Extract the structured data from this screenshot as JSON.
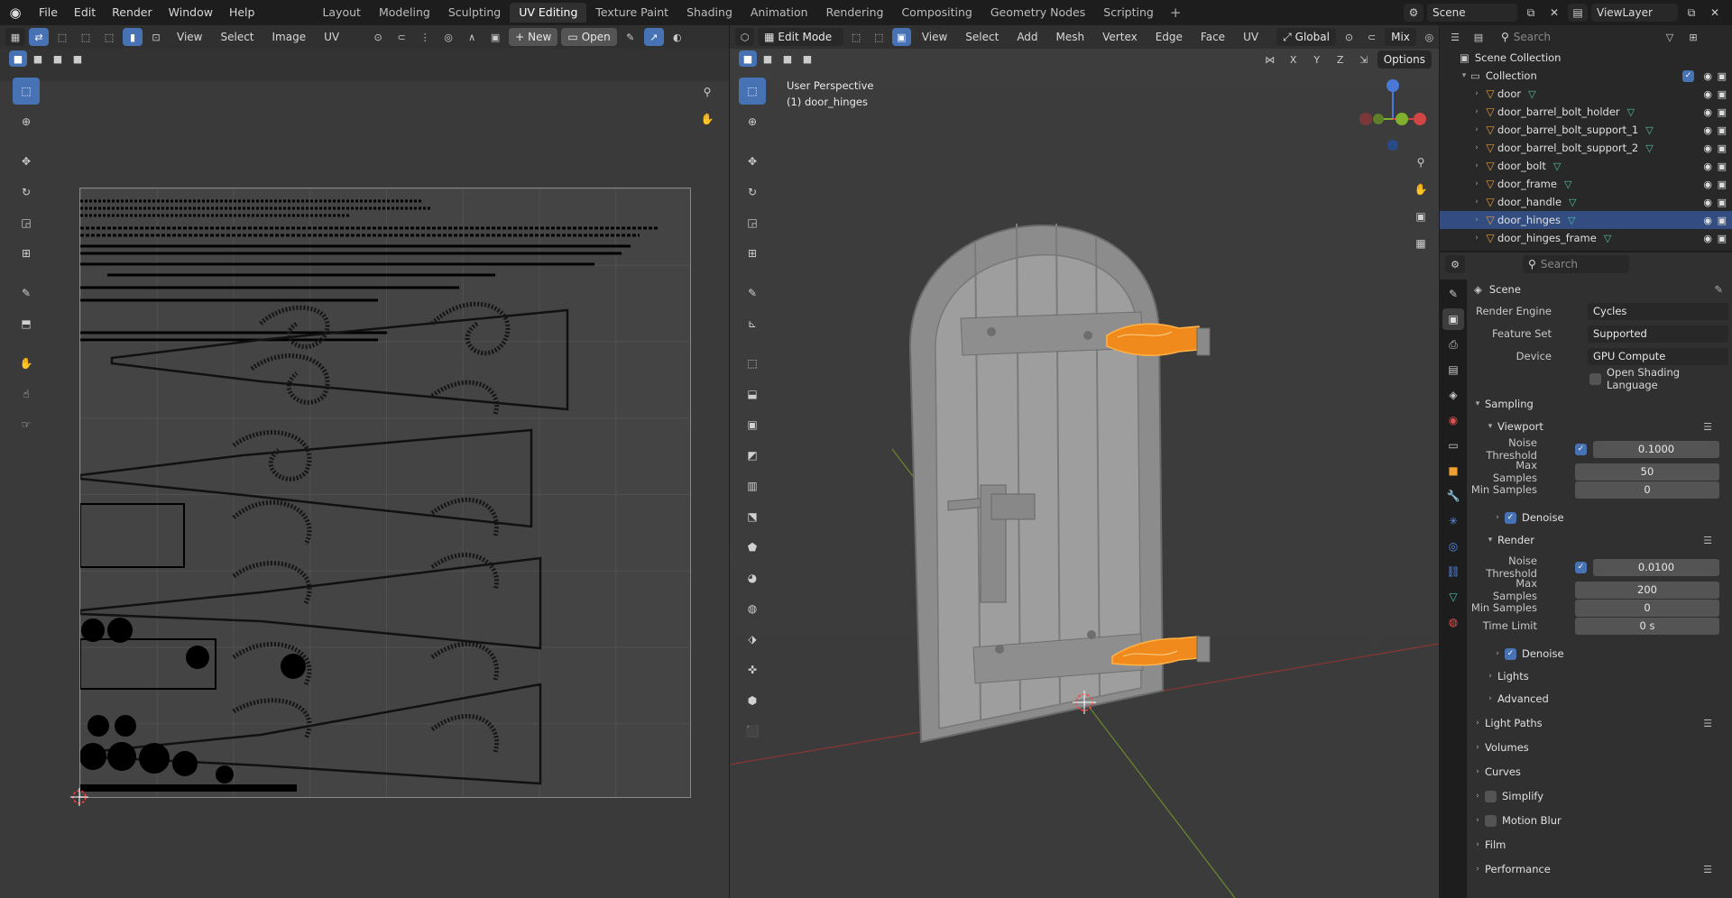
{
  "topbar": {
    "menus": [
      "File",
      "Edit",
      "Render",
      "Window",
      "Help"
    ],
    "workspaces": [
      "Layout",
      "Modeling",
      "Sculpting",
      "UV Editing",
      "Texture Paint",
      "Shading",
      "Animation",
      "Rendering",
      "Compositing",
      "Geometry Nodes",
      "Scripting"
    ],
    "active_workspace": "UV Editing",
    "add_workspace": "+",
    "scene_name": "Scene",
    "view_layer": "ViewLayer"
  },
  "uv_editor": {
    "menus": [
      "View",
      "Select",
      "Image",
      "UV"
    ],
    "new_label": "New",
    "open_label": "Open"
  },
  "viewport": {
    "mode": "Edit Mode",
    "menus": [
      "View",
      "Select",
      "Add",
      "Mesh",
      "Vertex",
      "Edge",
      "Face",
      "UV"
    ],
    "orientation": "Global",
    "shading_mode": "Mix",
    "options_label": "Options",
    "view_name": "User Perspective",
    "object_label": "(1) door_hinges",
    "axis_labels": {
      "x": "X",
      "y": "Y",
      "z": "Z"
    },
    "colors": {
      "hinge": "#f08a1c",
      "door": "#9a9a9a",
      "x_axis": "#a13a3a",
      "y_axis": "#6a8a2a"
    }
  },
  "outliner": {
    "search_placeholder": "Search",
    "root": "Scene Collection",
    "collection": "Collection",
    "objects": [
      {
        "name": "door",
        "selected": false
      },
      {
        "name": "door_barrel_bolt_holder",
        "selected": false
      },
      {
        "name": "door_barrel_bolt_support_1",
        "selected": false
      },
      {
        "name": "door_barrel_bolt_support_2",
        "selected": false
      },
      {
        "name": "door_bolt",
        "selected": false
      },
      {
        "name": "door_frame",
        "selected": false
      },
      {
        "name": "door_handle",
        "selected": false
      },
      {
        "name": "door_hinges",
        "selected": true
      },
      {
        "name": "door_hinges_frame",
        "selected": false
      }
    ]
  },
  "properties": {
    "search_placeholder": "Search",
    "context": "Scene",
    "render_engine_label": "Render Engine",
    "render_engine": "Cycles",
    "feature_set_label": "Feature Set",
    "feature_set": "Supported",
    "device_label": "Device",
    "device": "GPU Compute",
    "osl_label": "Open Shading Language",
    "sampling": "Sampling",
    "viewport_panel": "Viewport",
    "noise_threshold_label": "Noise Threshold",
    "viewport_noise": "0.1000",
    "max_samples_label": "Max Samples",
    "viewport_max": "50",
    "min_samples_label": "Min Samples",
    "viewport_min": "0",
    "denoise_label": "Denoise",
    "render_panel": "Render",
    "render_noise": "0.0100",
    "render_max": "200",
    "render_min": "0",
    "time_limit_label": "Time Limit",
    "time_limit": "0 s",
    "lights": "Lights",
    "advanced": "Advanced",
    "light_paths": "Light Paths",
    "volumes": "Volumes",
    "curves": "Curves",
    "simplify": "Simplify",
    "motion_blur": "Motion Blur",
    "film": "Film",
    "performance": "Performance"
  }
}
